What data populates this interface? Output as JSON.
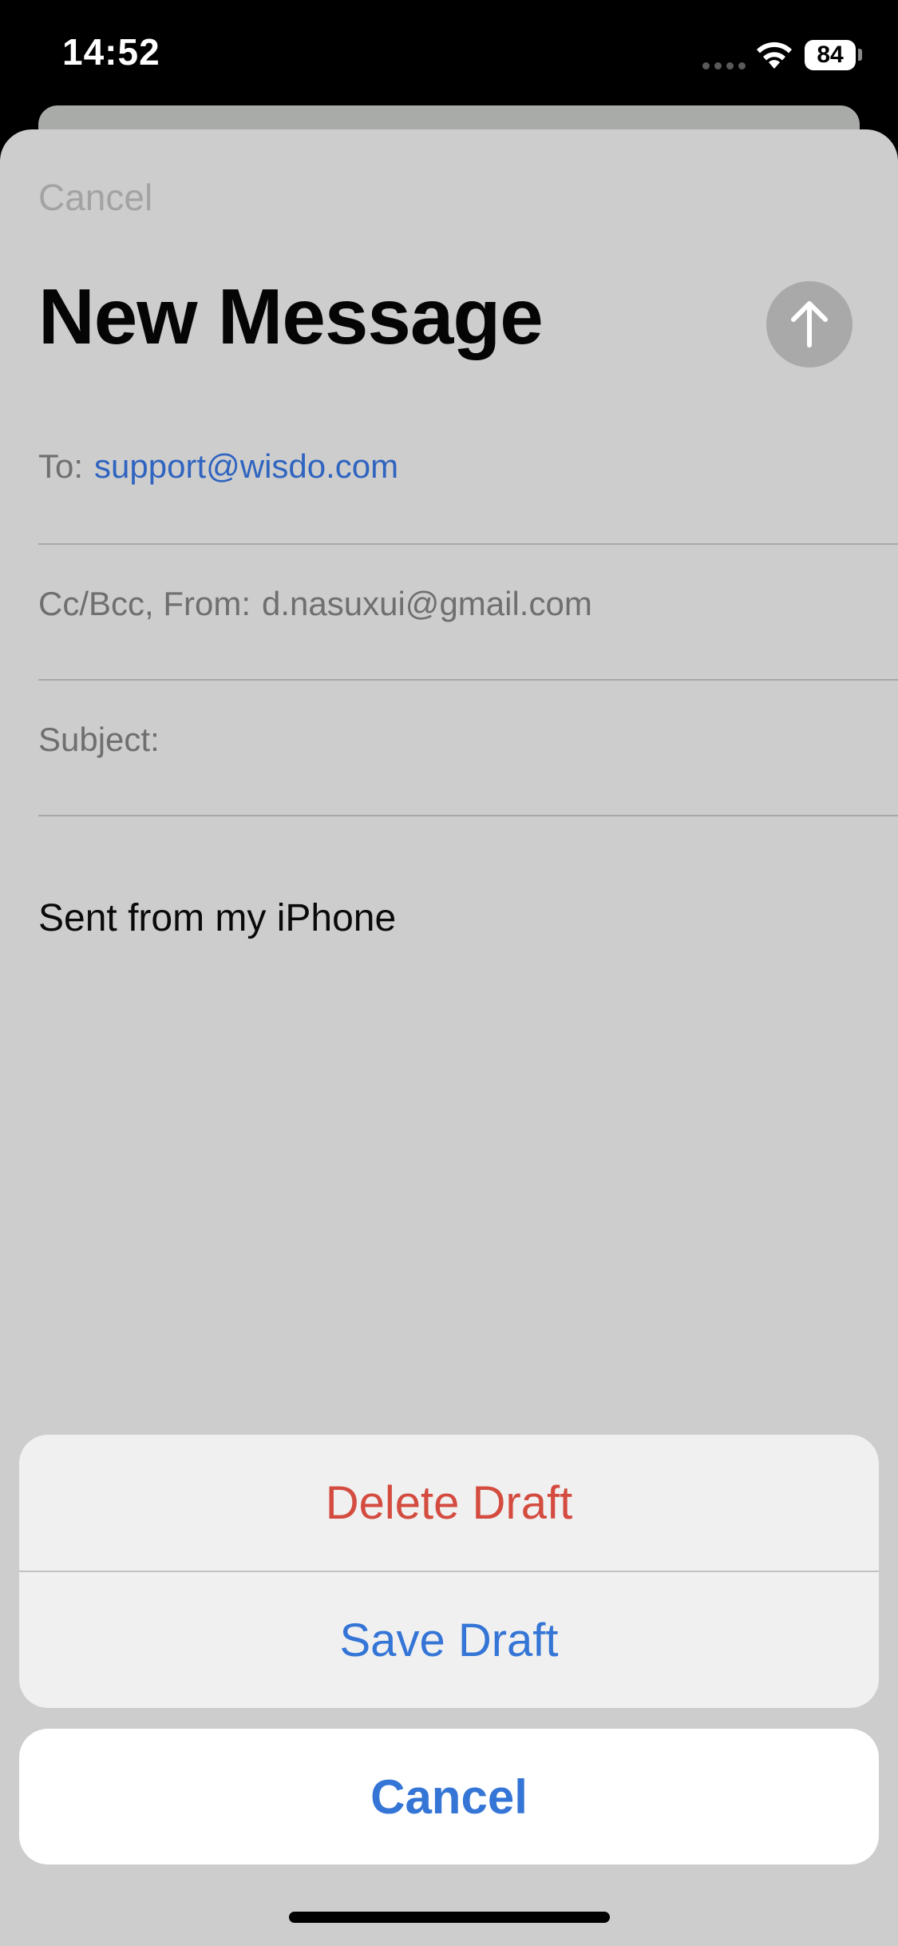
{
  "status_bar": {
    "time": "14:52",
    "battery_level": "84",
    "wifi_icon": "wifi-icon",
    "cellular_icon": "no-signal-dots-icon"
  },
  "compose": {
    "cancel_label": "Cancel",
    "title": "New Message",
    "send_icon": "arrow-up-icon",
    "to_label": "To:",
    "to_value": "support@wisdo.com",
    "ccbcc_label": "Cc/Bcc, From:",
    "from_value": "d.nasuxui@gmail.com",
    "subject_label": "Subject:",
    "body": "Sent from my iPhone"
  },
  "action_sheet": {
    "delete_label": "Delete Draft",
    "save_label": "Save Draft",
    "cancel_label": "Cancel"
  },
  "colors": {
    "destructive": "#d44b3f",
    "accent": "#3475d6",
    "link": "#2f64c0"
  }
}
